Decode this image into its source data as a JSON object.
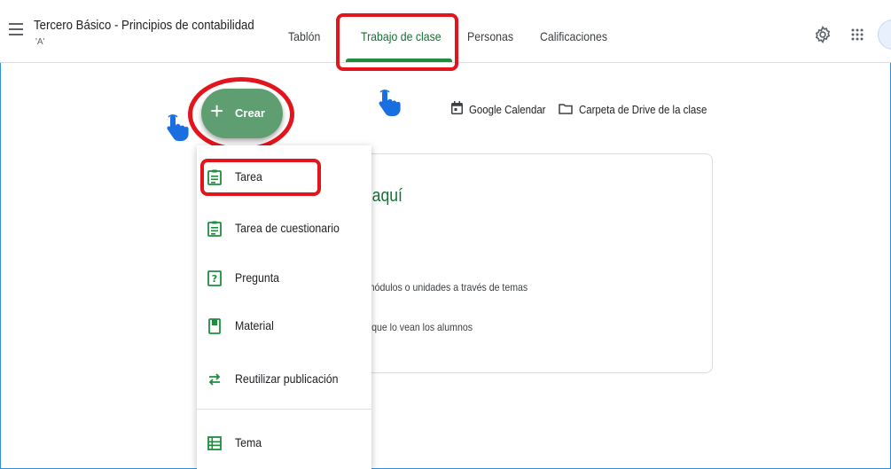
{
  "header": {
    "class_title": "Tercero Básico - Principios de contabilidad",
    "class_section": "'A'",
    "tabs": [
      {
        "label": "Tablón"
      },
      {
        "label": "Trabajo de clase"
      },
      {
        "label": "Personas"
      },
      {
        "label": "Calificaciones"
      }
    ],
    "active_tab": "Trabajo de clase"
  },
  "toolbar": {
    "create_label": "Crear",
    "calendar_label": "Google Calendar",
    "drive_label": "Carpeta de Drive de la clase"
  },
  "card": {
    "heading": "e aquí",
    "line1": "n módulos o unidades a través de temas",
    "line2": "es que lo vean los alumnos"
  },
  "create_menu": {
    "items": [
      {
        "label": "Tarea",
        "icon": "assignment-icon"
      },
      {
        "label": "Tarea de cuestionario",
        "icon": "quiz-assignment-icon"
      },
      {
        "label": "Pregunta",
        "icon": "question-icon"
      },
      {
        "label": "Material",
        "icon": "material-icon"
      },
      {
        "label": "Reutilizar publicación",
        "icon": "reuse-icon"
      },
      {
        "label": "Tema",
        "icon": "topic-icon"
      }
    ]
  },
  "colors": {
    "accent_green": "#1e8e3e",
    "create_button": "#5f9e70",
    "highlight_red": "#e3141b",
    "pointer_blue": "#1a6fe0"
  }
}
